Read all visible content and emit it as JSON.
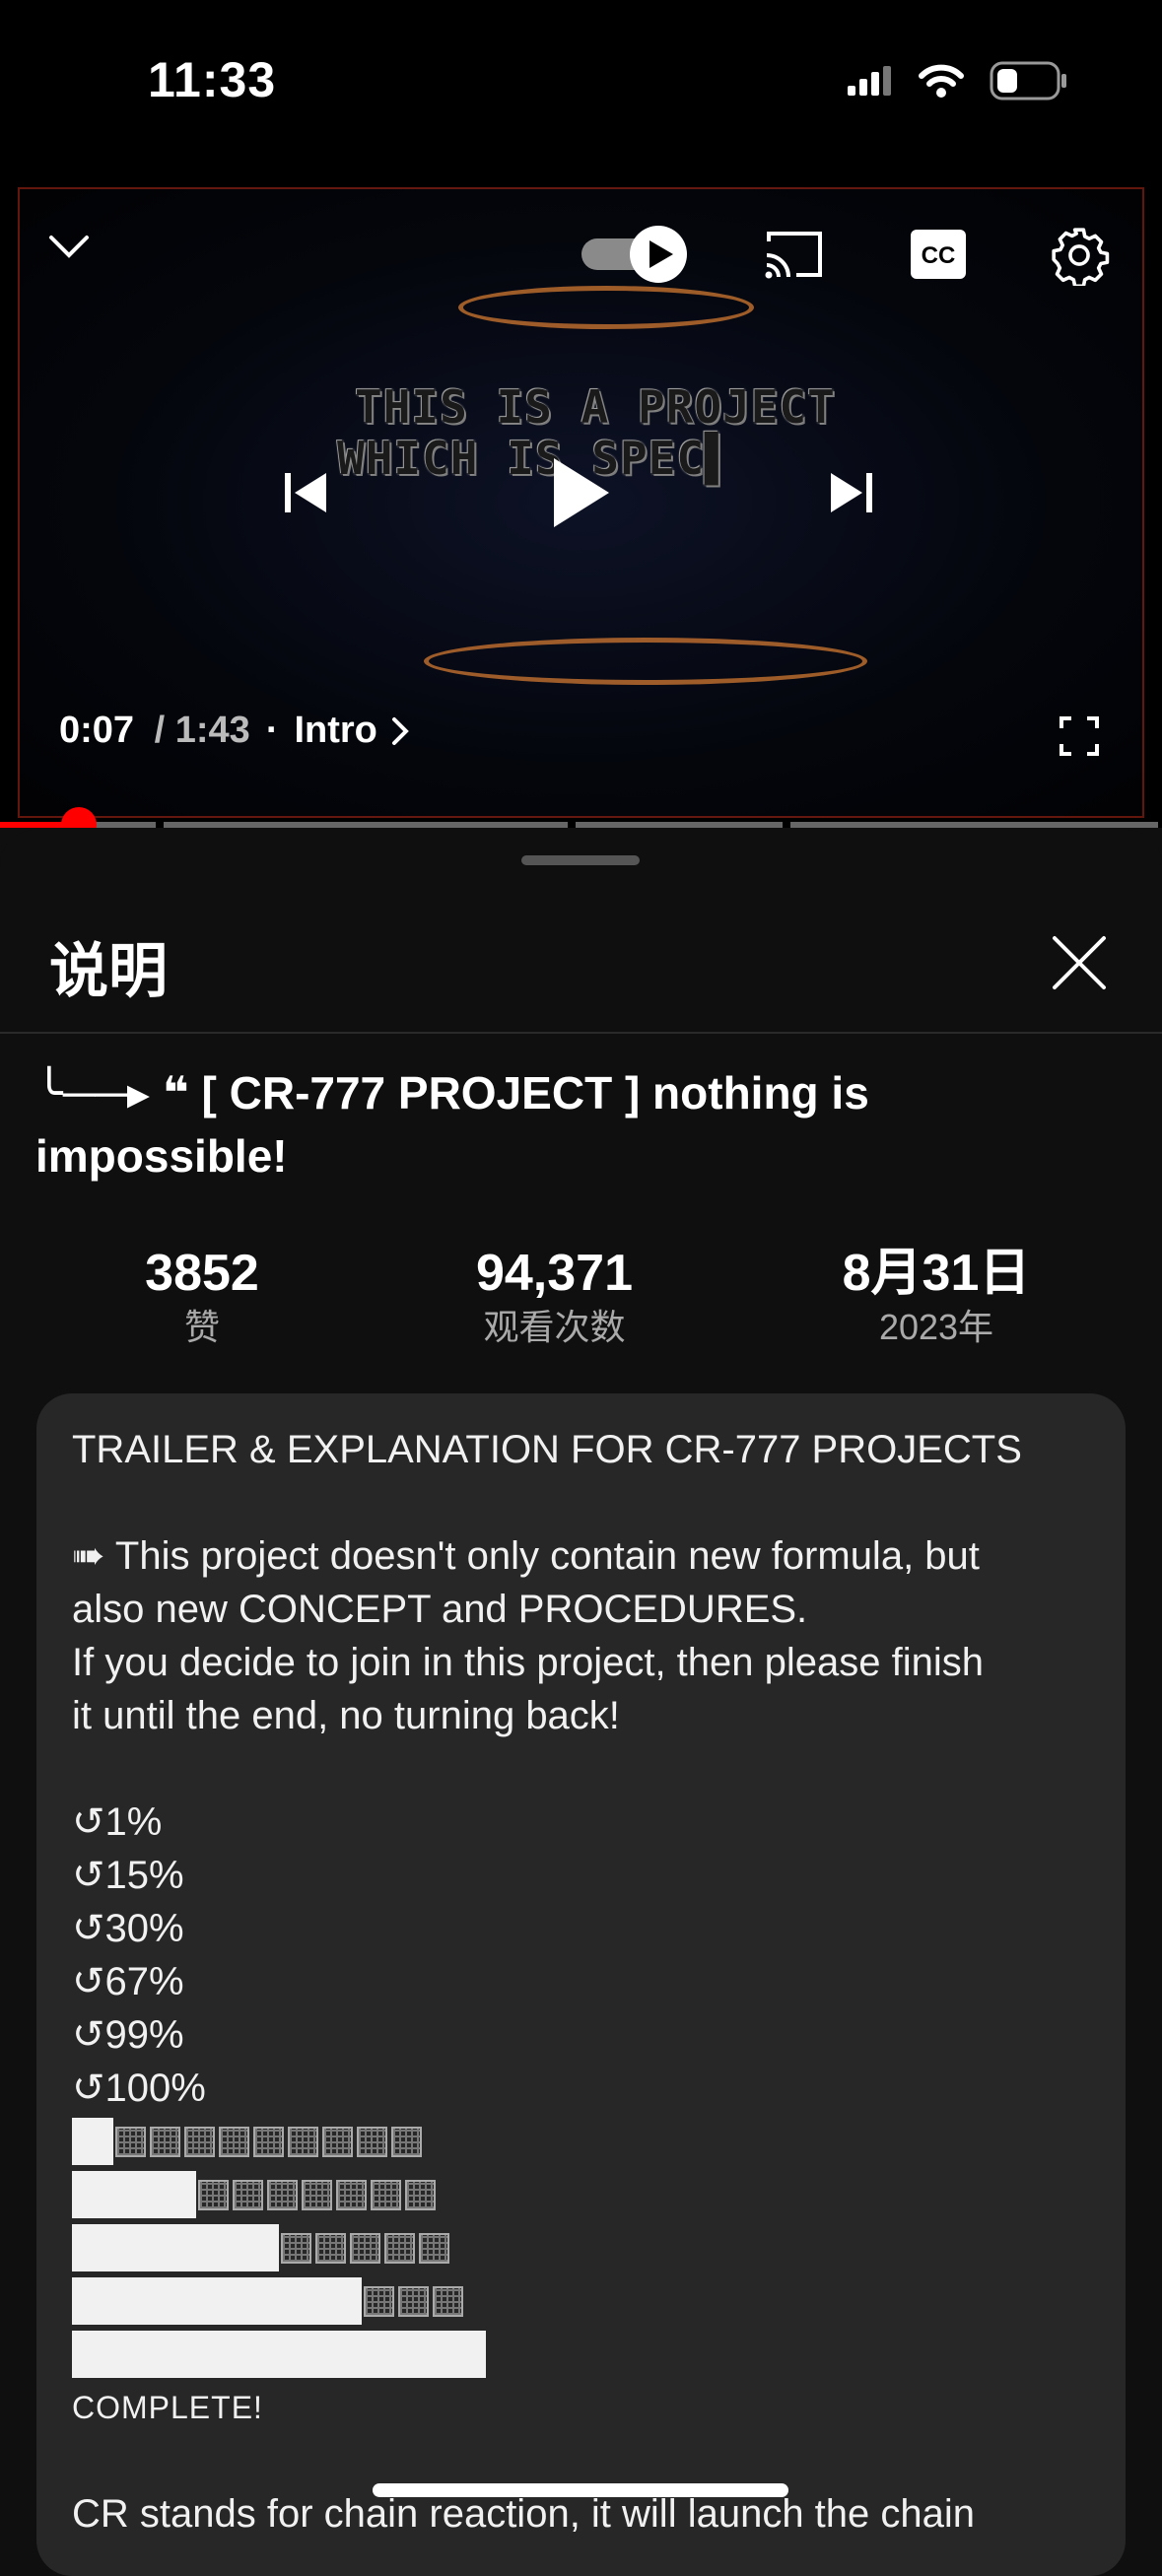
{
  "status_bar": {
    "time": "11:33",
    "battery_level": 0.35
  },
  "player": {
    "overlay_text_line1": "THIS IS A PROJECT",
    "overlay_text_line2": "WHICH IS SPEC▌",
    "current_time": "0:07",
    "separator": " / ",
    "total_time": "1:43",
    "dot": "·",
    "chapter": "Intro",
    "progress_fraction": 0.068,
    "chapter_markers": [
      0.0,
      0.137,
      0.492,
      0.677
    ],
    "autoplay_on": true,
    "icons": [
      "chevron-down-icon",
      "autoplay-toggle",
      "cast-icon",
      "cc-icon",
      "settings-icon",
      "previous-icon",
      "play-icon",
      "next-icon",
      "fullscreen-icon",
      "chevron-right-icon"
    ]
  },
  "sheet": {
    "title": "说明",
    "video_title": "╰──▸ ❝ [ CR-777 PROJECT ]  nothing is impossible!",
    "stats": [
      {
        "value": "3852",
        "label": "赞"
      },
      {
        "value": "94,371",
        "label": "观看次数"
      },
      {
        "value": "8月31日",
        "label": "2023年"
      }
    ],
    "description": {
      "heading": "TRAILER & EXPLANATION FOR CR-777 PROJECTS",
      "para1_line1": "➠ This project doesn't only contain new formula, but",
      "para1_line2": "also new CONCEPT and PROCEDURES.",
      "para1_line3": "If you decide to join in this project, then please finish",
      "para1_line4": "it until the end, no turning back!",
      "percents": [
        "↺1%",
        "↺15%",
        "↺30%",
        "↺67%",
        "↺99%",
        "↺100%"
      ],
      "progress_bars": [
        {
          "filled": 1,
          "empty": 9
        },
        {
          "filled": 3,
          "empty": 7
        },
        {
          "filled": 5,
          "empty": 5
        },
        {
          "filled": 7,
          "empty": 3
        },
        {
          "filled": 10,
          "empty": 0
        }
      ],
      "complete_text": "COMPLETE!",
      "tail": "CR stands for chain reaction, it will launch the chain"
    }
  },
  "colors": {
    "accent": "#ff0000",
    "sheet_bg": "#0f0f0f",
    "card_bg": "#272727"
  }
}
